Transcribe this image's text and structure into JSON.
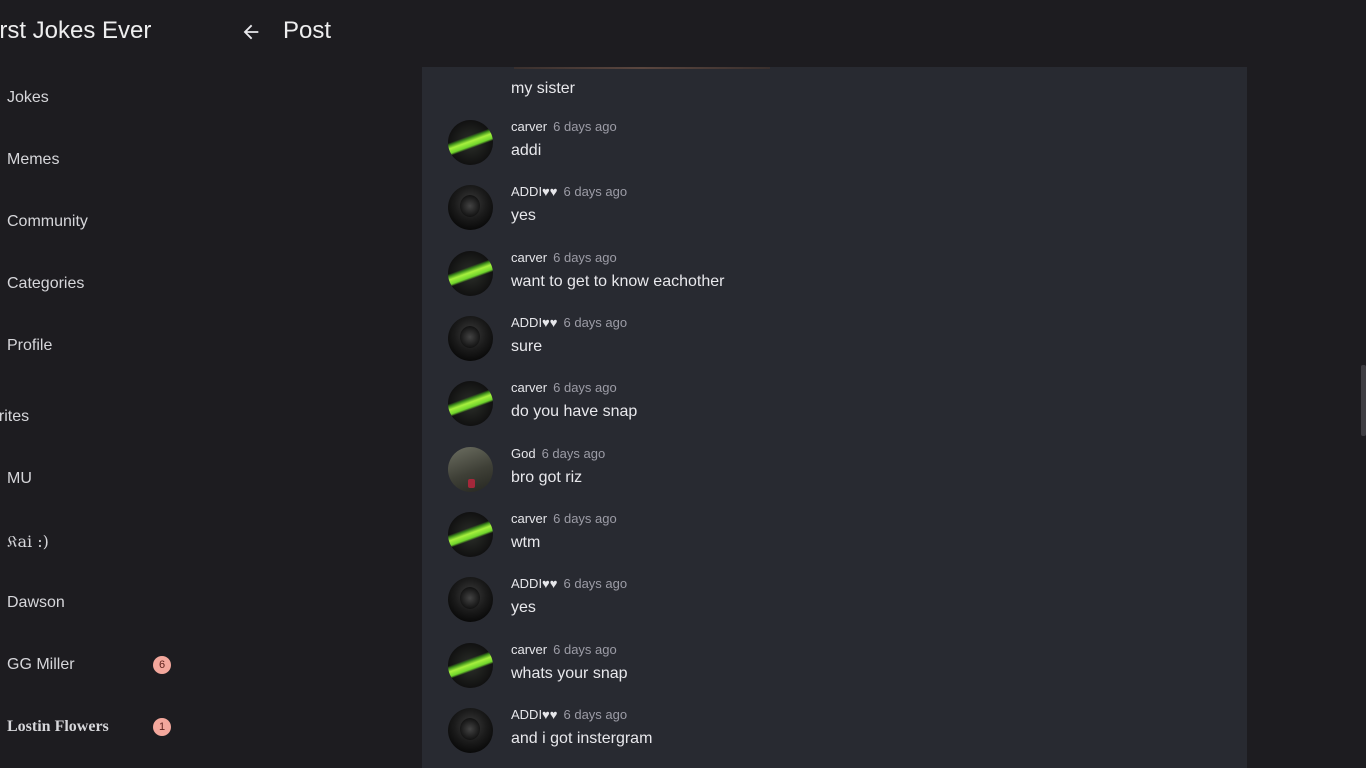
{
  "header": {
    "app_title": "orst Jokes Ever",
    "page_title": "Post"
  },
  "sidebar": {
    "items": [
      {
        "label": "Jokes"
      },
      {
        "label": "Memes"
      },
      {
        "label": "Community"
      },
      {
        "label": "Categories"
      },
      {
        "label": "Profile"
      }
    ],
    "favorites_label": "orites",
    "favorites": [
      {
        "label": "MU",
        "badge": ""
      },
      {
        "label": "𝔎ai :)",
        "badge": ""
      },
      {
        "label": "Dawson",
        "badge": ""
      },
      {
        "label": "GG Miller",
        "badge": "6"
      },
      {
        "label": "Lostin Flowers",
        "badge": "1"
      }
    ]
  },
  "post": {
    "first_message_text": "my sister"
  },
  "messages": [
    {
      "author": "carver",
      "time": "6 days ago",
      "text": "addi",
      "avatar": "carver-avatar"
    },
    {
      "author": "ADDI♥♥",
      "time": "6 days ago",
      "text": "yes",
      "avatar": "addi-avatar"
    },
    {
      "author": "carver",
      "time": "6 days ago",
      "text": "want to get to know eachother",
      "avatar": "carver-avatar"
    },
    {
      "author": "ADDI♥♥",
      "time": "6 days ago",
      "text": "sure",
      "avatar": "addi-avatar"
    },
    {
      "author": "carver",
      "time": "6 days ago",
      "text": "do you have snap",
      "avatar": "carver-avatar"
    },
    {
      "author": "God",
      "time": "6 days ago",
      "text": "bro got riz",
      "avatar": "god-avatar"
    },
    {
      "author": "carver",
      "time": "6 days ago",
      "text": "wtm",
      "avatar": "carver-avatar"
    },
    {
      "author": "ADDI♥♥",
      "time": "6 days ago",
      "text": "yes",
      "avatar": "addi-avatar"
    },
    {
      "author": "carver",
      "time": "6 days ago",
      "text": "whats your snap",
      "avatar": "carver-avatar"
    },
    {
      "author": "ADDI♥♥",
      "time": "6 days ago",
      "text": "and i got instergram",
      "avatar": "addi-avatar"
    }
  ],
  "colors": {
    "background": "#1d1c20",
    "panel": "#282a31",
    "badge": "#f3a79c"
  },
  "icons": {
    "back": "arrow-left-icon"
  }
}
